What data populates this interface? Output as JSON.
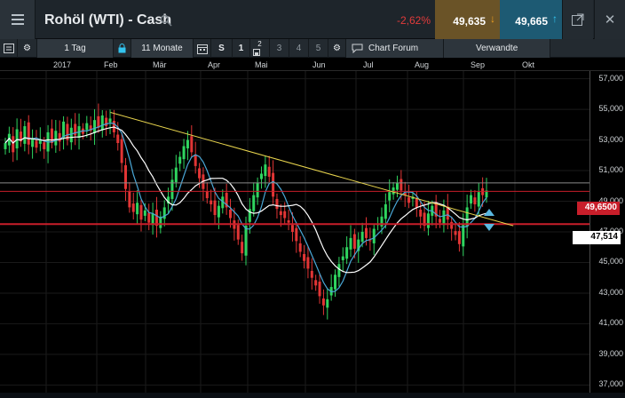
{
  "header": {
    "title": "Rohöl (WTI) - Cash",
    "change": "-2,62%",
    "bid": "49,635",
    "ask": "49,665",
    "icons": [
      "menu-icon",
      "search-icon",
      "arrow-down-icon",
      "arrow-up-icon",
      "popout-icon",
      "close-icon"
    ]
  },
  "toolbar": {
    "interval": "1 Tag",
    "range": "11 Monate",
    "s_label": "S",
    "n1": "1",
    "n2": "2",
    "n3": "3",
    "n4": "4",
    "n5": "5",
    "forum": "Chart Forum",
    "related": "Verwandte",
    "icons": [
      "list-icon",
      "gear-icon",
      "lock-icon",
      "calendar-icon",
      "save-icon",
      "gear-icon",
      "chat-icon"
    ]
  },
  "axis": {
    "months": [
      "2017",
      "Feb",
      "Mär",
      "Apr",
      "Mai",
      "Jun",
      "Jul",
      "Aug",
      "Sep",
      "Okt"
    ],
    "prices": [
      "57,000",
      "55,000",
      "53,000",
      "51,000",
      "49,000",
      "47,000",
      "45,000",
      "43,000",
      "41,000",
      "39,000",
      "37,000"
    ]
  },
  "chart_data": {
    "type": "candlestick",
    "ylim": [
      36.5,
      57.5
    ],
    "current_price_label": "49,6500",
    "reference_price_label": "47,514",
    "horizontal_lines": [
      49.65,
      47.51,
      50.2
    ],
    "trendline": {
      "from": {
        "date": "2017-02-10",
        "price": 54.8
      },
      "to": {
        "date": "2017-10-05",
        "price": 47.4
      }
    },
    "colors": {
      "up": "#2fd55f",
      "down": "#e23535",
      "ma_fast": "#4aa8d8",
      "ma_slow": "#ffffff",
      "trend": "#e8d44d",
      "price_line": "#c81e2a"
    },
    "closes": [
      52.8,
      53.4,
      52.2,
      53.7,
      52.9,
      53.9,
      52.7,
      53.1,
      52.5,
      53.0,
      52.4,
      53.5,
      52.8,
      53.6,
      52.9,
      54.2,
      53.0,
      53.8,
      53.3,
      53.9,
      53.4,
      54.1,
      53.6,
      54.3,
      53.8,
      54.6,
      53.9,
      54.4,
      53.5,
      52.8,
      51.5,
      49.8,
      48.6,
      48.3,
      48.9,
      47.8,
      48.4,
      47.6,
      48.2,
      47.4,
      48.0,
      48.6,
      49.3,
      50.4,
      51.2,
      51.9,
      52.6,
      53.0,
      52.2,
      51.3,
      50.5,
      49.8,
      49.2,
      48.8,
      48.1,
      48.7,
      49.3,
      48.6,
      47.9,
      47.2,
      46.5,
      45.6,
      47.4,
      48.5,
      49.4,
      50.2,
      50.8,
      51.4,
      50.6,
      49.3,
      48.5,
      48.1,
      47.9,
      47.6,
      47.0,
      46.4,
      45.7,
      45.1,
      44.6,
      44.0,
      43.5,
      42.8,
      42.2,
      42.6,
      43.4,
      44.2,
      44.9,
      45.4,
      46.0,
      46.6,
      45.9,
      46.5,
      47.0,
      46.6,
      46.4,
      47.2,
      47.5,
      48.0,
      48.8,
      49.6,
      49.9,
      50.2,
      49.7,
      49.4,
      48.9,
      49.3,
      48.6,
      48.0,
      47.4,
      48.2,
      48.7,
      48.0,
      47.6,
      48.4,
      47.8,
      47.2,
      46.8,
      46.2,
      47.5,
      48.6,
      49.4,
      48.8,
      49.6,
      49.4,
      49.7
    ]
  }
}
